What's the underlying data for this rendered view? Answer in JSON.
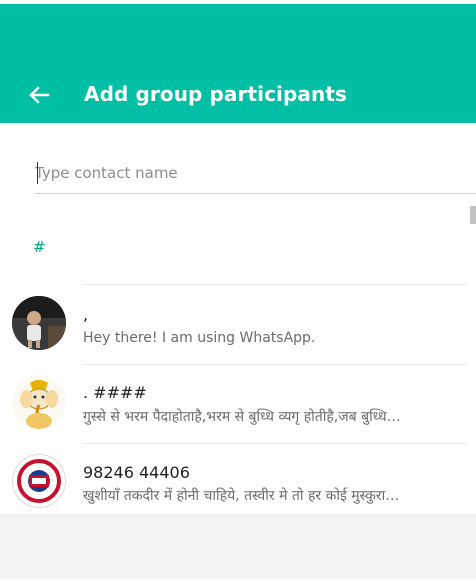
{
  "header": {
    "title": "Add group participants",
    "back_icon": "arrow-left-icon",
    "color": "#00bfa5"
  },
  "search": {
    "placeholder": "Type contact name",
    "value": ""
  },
  "section": {
    "letter": "#"
  },
  "contacts": [
    {
      "name": ",",
      "status": "Hey there! I am using WhatsApp.",
      "avatar": "child-photo-avatar"
    },
    {
      "name": ". ####",
      "status": "गुस्से से भरम पैदाहोताहै,भरम से बुध्धि व्यगृ होतीहै,जब बुध्धि…",
      "avatar": "ganesha-avatar"
    },
    {
      "name": "98246 44406",
      "status": "खुशीयाँ तकदीर में होनी चाहिये, तस्वीर मे तो हर कोई मुस्कुरा…",
      "avatar": "bamdev-xerox-logo-avatar"
    }
  ]
}
